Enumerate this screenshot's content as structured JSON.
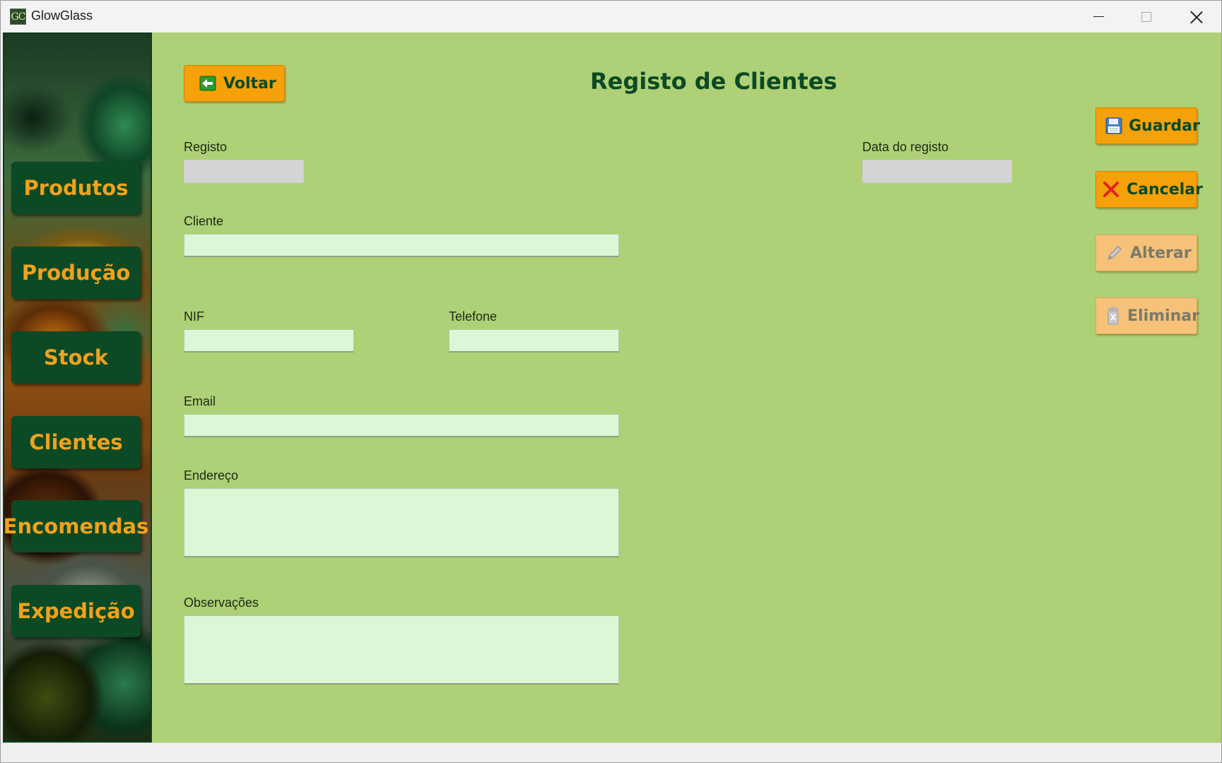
{
  "window": {
    "title": "GlowGlass",
    "icon_text": "GC",
    "controls": [
      "minimize",
      "maximize",
      "close"
    ]
  },
  "sidebar": {
    "items": [
      {
        "label": "Produtos"
      },
      {
        "label": "Produção"
      },
      {
        "label": "Stock"
      },
      {
        "label": "Clientes"
      },
      {
        "label": "Encomendas"
      },
      {
        "label": "Expedição"
      }
    ]
  },
  "header": {
    "title": "Registo de Clientes",
    "back_label": "Voltar"
  },
  "actions": {
    "save_label": "Guardar",
    "cancel_label": "Cancelar",
    "edit_label": "Alterar",
    "delete_label": "Eliminar"
  },
  "form": {
    "registo": {
      "label": "Registo",
      "value": ""
    },
    "data_registo": {
      "label": "Data do registo",
      "value": ""
    },
    "cliente": {
      "label": "Cliente",
      "value": ""
    },
    "nif": {
      "label": "NIF",
      "value": ""
    },
    "telefone": {
      "label": "Telefone",
      "value": ""
    },
    "email": {
      "label": "Email",
      "value": ""
    },
    "endereco": {
      "label": "Endereço",
      "value": ""
    },
    "observacoes": {
      "label": "Observações",
      "value": ""
    }
  },
  "colors": {
    "background": "#aed076",
    "accent_orange": "#f5a10a",
    "nav_green": "#0b4a25",
    "nav_text": "#f0a11d",
    "input_fill": "#dcf7d8",
    "readonly_fill": "#d4d4d4"
  },
  "icons": {
    "back": "arrow-left-icon",
    "save": "floppy-disk-icon",
    "cancel": "red-x-icon",
    "edit": "pencil-icon",
    "delete": "trash-icon"
  }
}
